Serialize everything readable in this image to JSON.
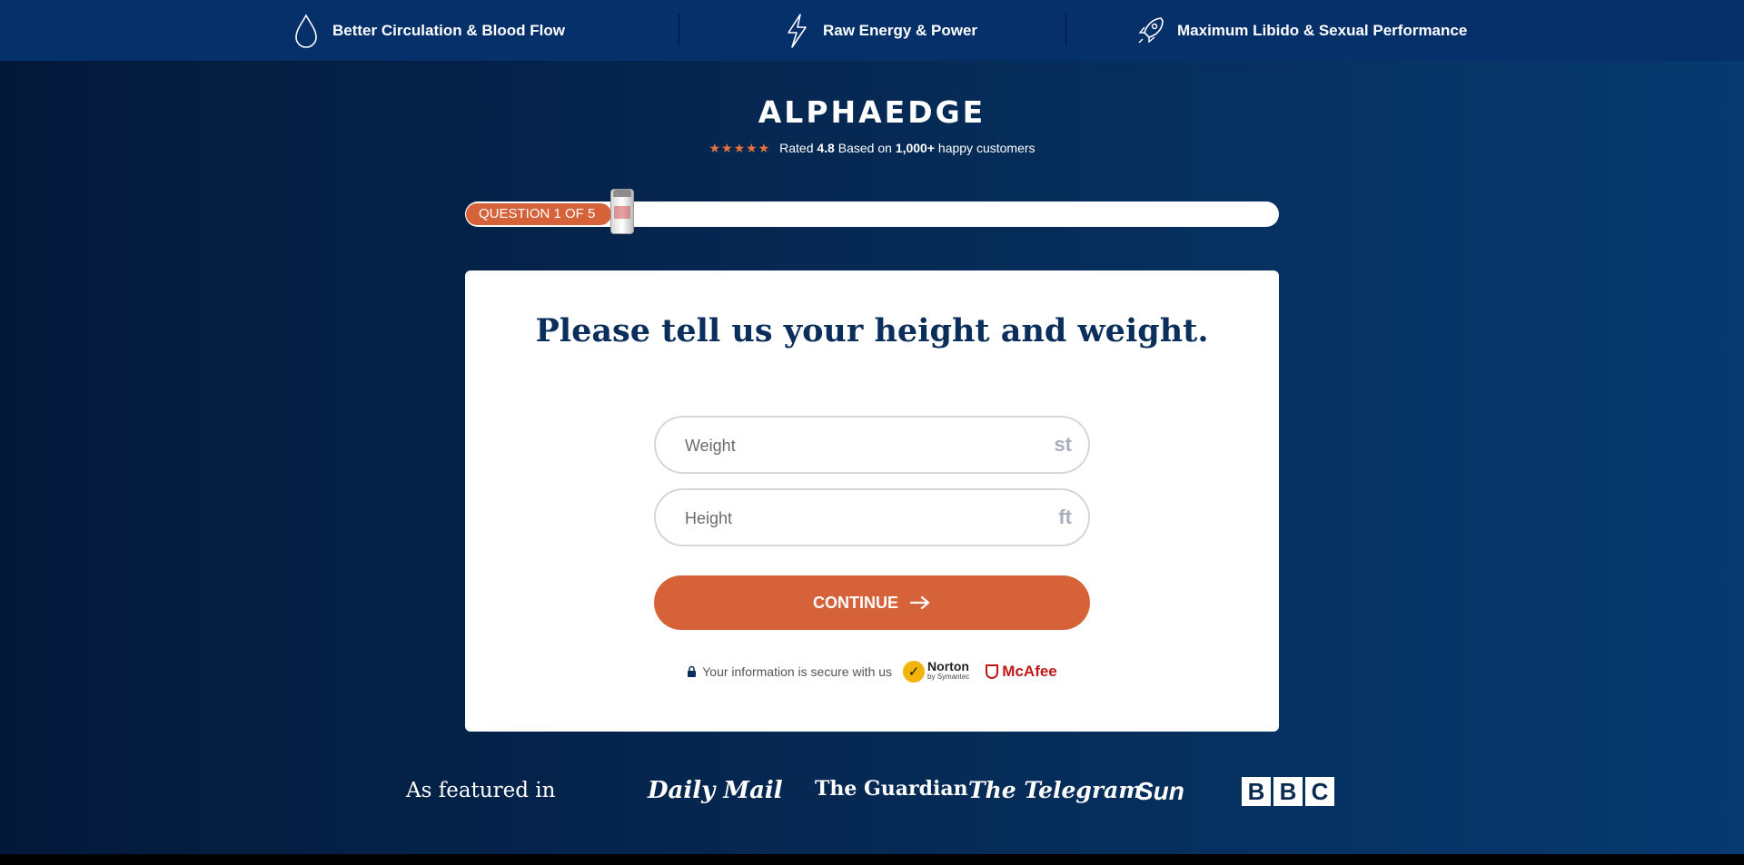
{
  "benefits": [
    {
      "label": "Better Circulation & Blood Flow",
      "icon": "droplet-icon"
    },
    {
      "label": "Raw Energy & Power",
      "icon": "lightning-icon"
    },
    {
      "label": "Maximum Libido & Sexual Performance",
      "icon": "rocket-icon"
    }
  ],
  "brand": {
    "logo": "ALPHAEDGE",
    "rating_prefix": "Rated",
    "rating_value": "4.8",
    "rating_middle": "Based on",
    "customers": "1,000+",
    "rating_suffix": "happy customers",
    "stars": "★★★★★"
  },
  "progress": {
    "label": "QUESTION 1 OF 5",
    "fraction": 0.2
  },
  "question": {
    "title": "Please tell us your height and weight."
  },
  "form": {
    "weight_placeholder": "Weight",
    "weight_unit": "st",
    "height_placeholder": "Height",
    "height_unit": "ft",
    "continue_label": "CONTINUE"
  },
  "secure": {
    "text": "Your information is secure with us",
    "norton": "Norton",
    "norton_sub": "by Symantec",
    "mcafee": "McAfee"
  },
  "featured": {
    "label": "As featured in",
    "outlets": [
      "Daily Mail",
      "The Guardian",
      "The Telegram",
      "Sun",
      "BBC"
    ]
  },
  "colors": {
    "accent": "#d6623a",
    "navy": "#0b2f5c",
    "topbar": "#06306a"
  }
}
